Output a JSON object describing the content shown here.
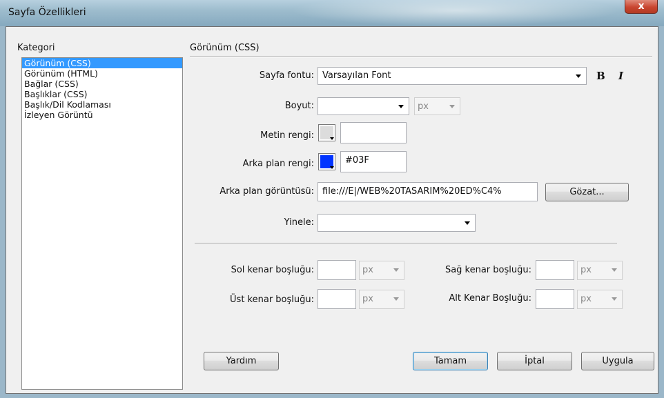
{
  "window": {
    "title": "Sayfa Özellikleri",
    "close_glyph": "x"
  },
  "category": {
    "label": "Kategori",
    "items": [
      "Görünüm (CSS)",
      "Görünüm (HTML)",
      "Bağlar (CSS)",
      "Başlıklar (CSS)",
      "Başlık/Dil Kodlaması",
      "İzleyen Görüntü"
    ],
    "selected_index": 0
  },
  "section": {
    "title": "Görünüm (CSS)"
  },
  "form": {
    "page_font": {
      "label": "Sayfa fontu:",
      "value": "Varsayılan Font",
      "bold_glyph": "B",
      "italic_glyph": "I"
    },
    "size": {
      "label": "Boyut:",
      "value": "",
      "unit": "px"
    },
    "text_color": {
      "label": "Metin rengi:",
      "value": ""
    },
    "bg_color": {
      "label": "Arka plan rengi:",
      "value": "#03F",
      "swatch": "#0033ff"
    },
    "bg_image": {
      "label": "Arka plan görüntüsü:",
      "value": "file:///E|/WEB%20TASARIM%20ED%C4%",
      "browse": "Gözat..."
    },
    "repeat": {
      "label": "Yinele:",
      "value": ""
    },
    "margins": {
      "left": {
        "label": "Sol kenar boşluğu:",
        "value": "",
        "unit": "px"
      },
      "right": {
        "label": "Sağ kenar boşluğu:",
        "value": "",
        "unit": "px"
      },
      "top": {
        "label": "Üst kenar boşluğu:",
        "value": "",
        "unit": "px"
      },
      "bottom": {
        "label": "Alt Kenar Boşluğu:",
        "value": "",
        "unit": "px"
      }
    }
  },
  "buttons": {
    "help": "Yardım",
    "ok": "Tamam",
    "cancel": "İptal",
    "apply": "Uygula"
  }
}
